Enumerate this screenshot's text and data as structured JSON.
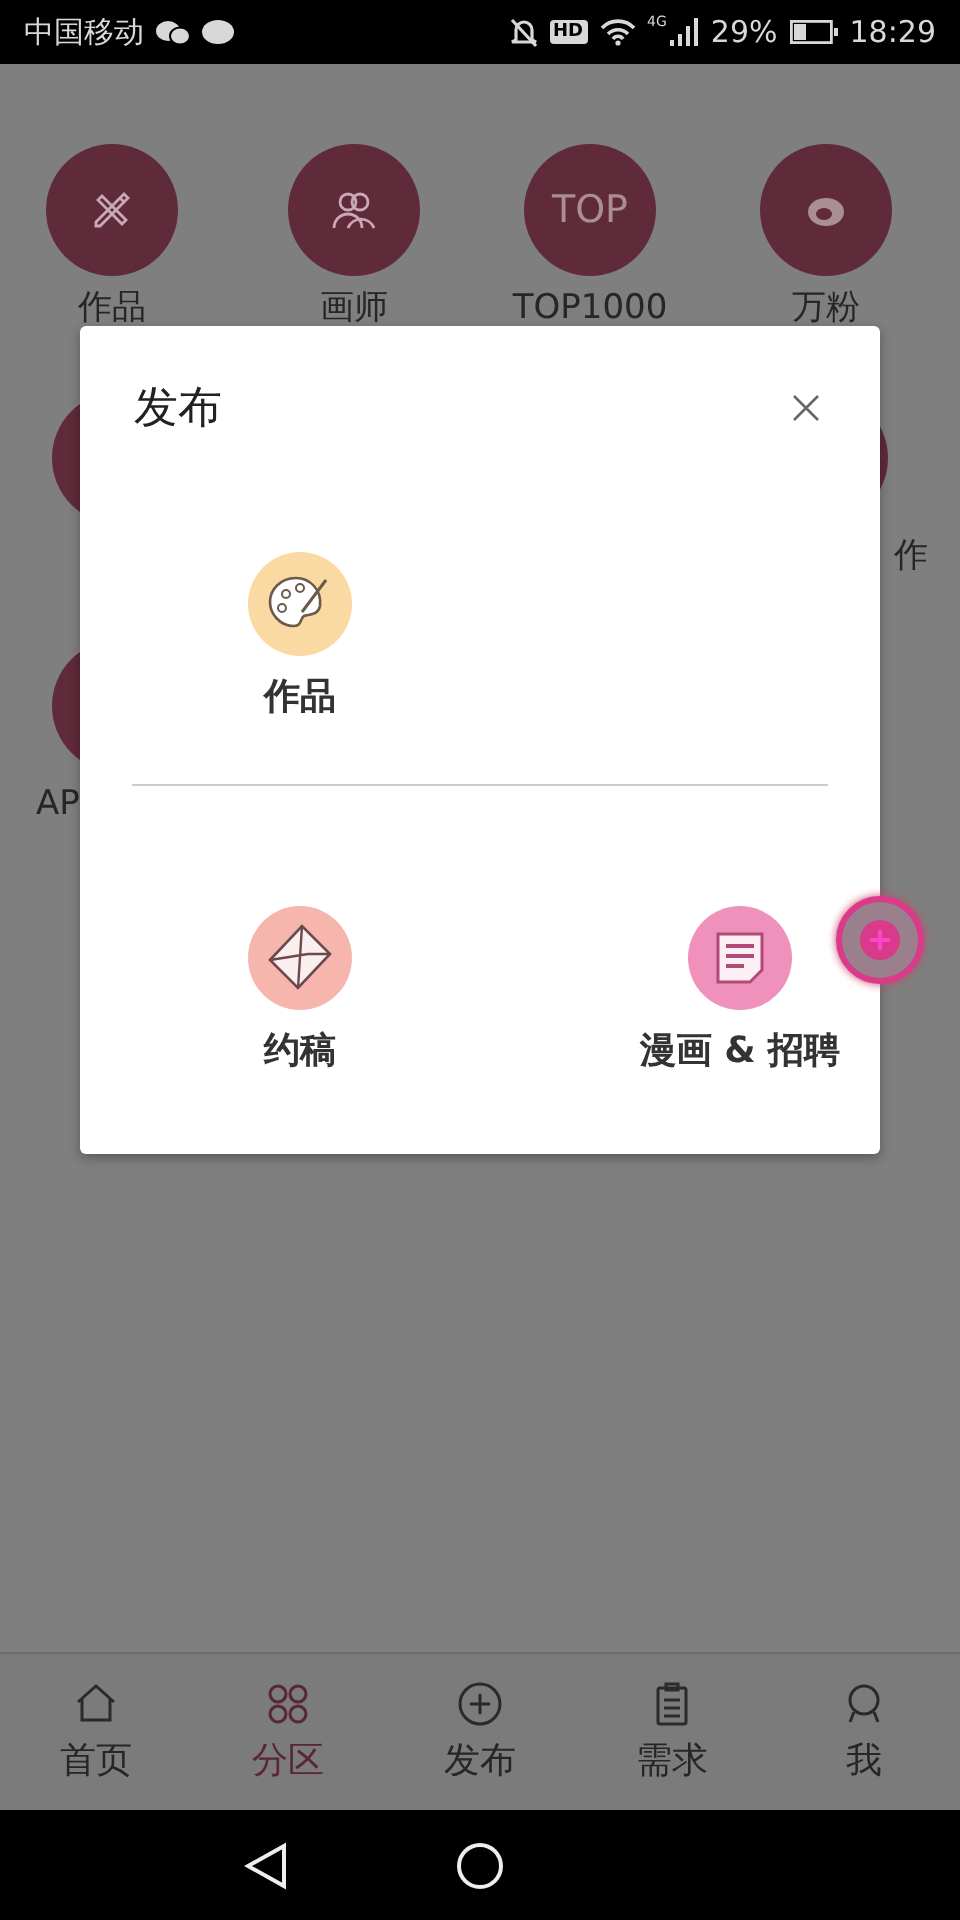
{
  "status_bar": {
    "carrier": "中国移动",
    "hd": "HD",
    "network": "4G",
    "battery": "29%",
    "time": "18:29"
  },
  "categories": [
    {
      "kind": "pencil",
      "label": "作品"
    },
    {
      "kind": "people",
      "label": "画师"
    },
    {
      "kind": "text",
      "circle_text": "TOP",
      "label": "TOP1000"
    },
    {
      "kind": "weibo",
      "label": "万粉"
    },
    {
      "kind": "blank"
    },
    {
      "kind": "blank",
      "label": "作"
    },
    {
      "kind": "blank",
      "label": "AP"
    }
  ],
  "dialog": {
    "title": "发布",
    "options": [
      {
        "kind": "palette",
        "label": "作品"
      },
      {
        "kind": "envelope",
        "label": "约稿"
      },
      {
        "kind": "document",
        "label": "漫画 & 招聘"
      }
    ]
  },
  "tabs": [
    {
      "kind": "home",
      "label": "首页",
      "selected": false
    },
    {
      "kind": "grid",
      "label": "分区",
      "selected": true
    },
    {
      "kind": "plus",
      "label": "发布",
      "selected": false
    },
    {
      "kind": "clipboard",
      "label": "需求",
      "selected": false
    },
    {
      "kind": "avatar",
      "label": "我",
      "selected": false
    }
  ]
}
